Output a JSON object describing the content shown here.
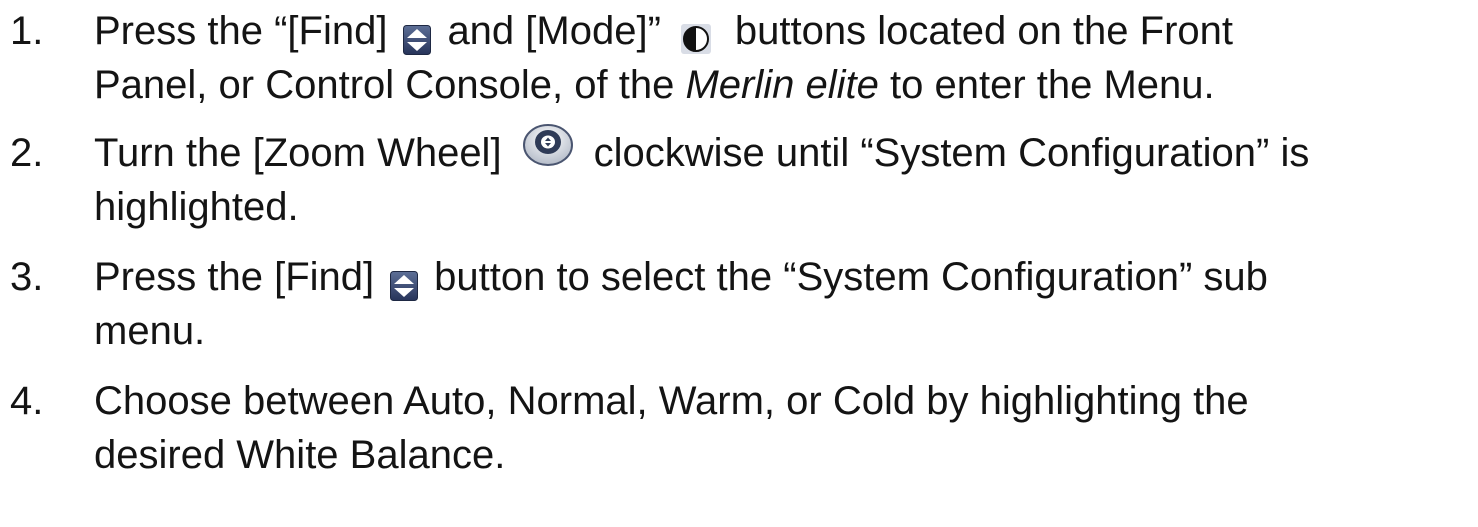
{
  "steps": [
    {
      "number": "1.",
      "line1_a": "Press the “[Find]",
      "line1_b": "and [Mode]”",
      "line1_c": "buttons located on the Front",
      "line2_a": "Panel, or Control Console, of the",
      "line2_em": "Merlin elite",
      "line2_b": "to enter the Menu.",
      "icons": [
        "find-icon",
        "mode-icon"
      ]
    },
    {
      "number": "2.",
      "line1_a": "Turn the [Zoom Wheel]",
      "line1_b": "clockwise until “System Configuration” is",
      "line2_a": "highlighted.",
      "icons": [
        "zoom-wheel-icon"
      ]
    },
    {
      "number": "3.",
      "line1_a": "Press the [Find]",
      "line1_b": "button to select the “System Configuration” sub",
      "line2_a": "menu.",
      "icons": [
        "find-icon"
      ]
    },
    {
      "number": "4.",
      "line1_a": "Choose between Auto, Normal, Warm, or Cold by highlighting the",
      "line2_a": "desired White Balance."
    }
  ],
  "colors": {
    "text": "#141414",
    "find_icon_fill": "#3b4a6e",
    "mode_icon_fill": "#1a1a1a",
    "zoom_wheel_face": "#2f3b57"
  }
}
